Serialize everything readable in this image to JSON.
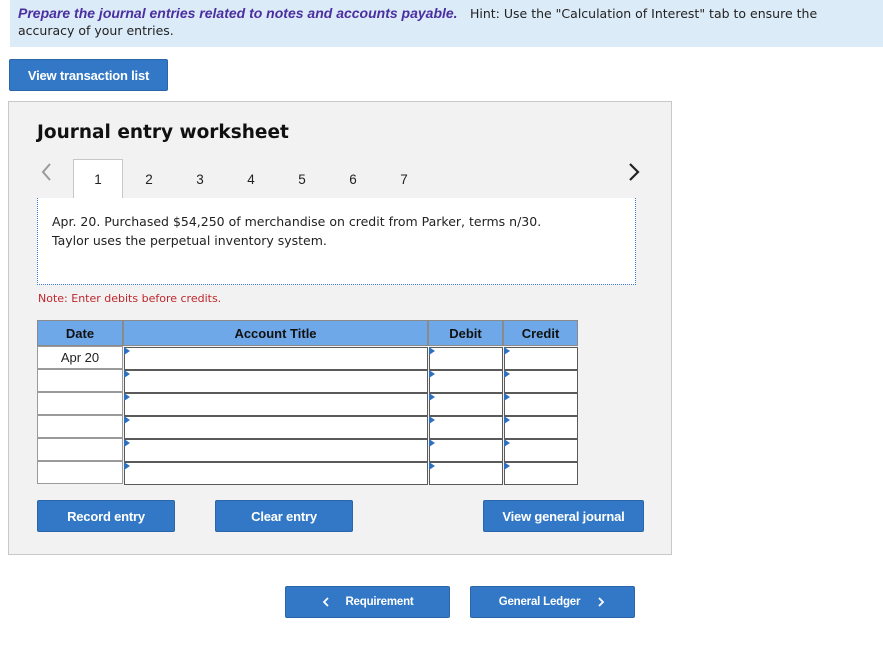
{
  "hint_bar": {
    "lead": "Prepare the journal entries related to notes and accounts payable.",
    "hint": "Hint:  Use the \"Calculation of Interest\" tab to ensure the",
    "hint_line2": "accuracy of your entries."
  },
  "view_transaction_list": "View transaction list",
  "worksheet": {
    "title": "Journal entry worksheet",
    "tabs": [
      "1",
      "2",
      "3",
      "4",
      "5",
      "6",
      "7"
    ],
    "active_tab": "1",
    "description_line1": "Apr. 20. Purchased $54,250 of merchandise on credit from Parker, terms n/30.",
    "description_line2": "Taylor uses the perpetual inventory system.",
    "note": "Note: Enter debits before credits.",
    "columns": {
      "date": "Date",
      "account": "Account Title",
      "debit": "Debit",
      "credit": "Credit"
    },
    "rows": [
      {
        "date": "Apr 20",
        "account": "",
        "debit": "",
        "credit": ""
      },
      {
        "date": "",
        "account": "",
        "debit": "",
        "credit": ""
      },
      {
        "date": "",
        "account": "",
        "debit": "",
        "credit": ""
      },
      {
        "date": "",
        "account": "",
        "debit": "",
        "credit": ""
      },
      {
        "date": "",
        "account": "",
        "debit": "",
        "credit": ""
      },
      {
        "date": "",
        "account": "",
        "debit": "",
        "credit": ""
      }
    ],
    "buttons": {
      "record": "Record entry",
      "clear": "Clear entry",
      "view_journal": "View general journal"
    }
  },
  "nav": {
    "requirement": "Requirement",
    "general_ledger": "General Ledger"
  },
  "colors": {
    "button_blue": "#3278c6",
    "header_blue": "#6fa8e8",
    "hint_bg": "#dcebf8",
    "note_red": "#c0272d",
    "lead_purple": "#4b2fa0"
  }
}
